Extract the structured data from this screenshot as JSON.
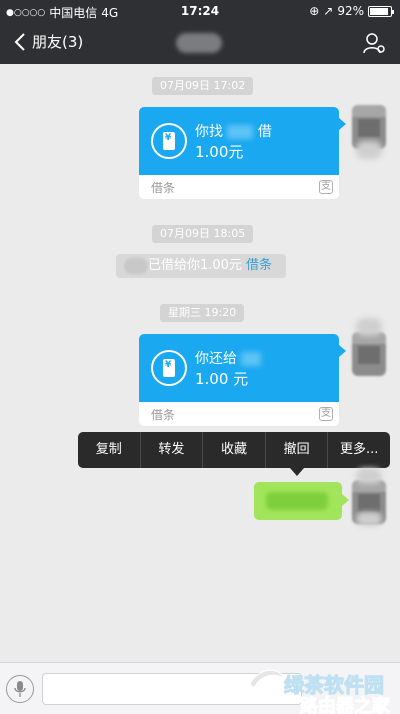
{
  "status_bar": {
    "signal": "●○○○○",
    "carrier": "中国电信",
    "network": "4G",
    "time": "17:24",
    "battery": "92%",
    "battery_level": 0.92
  },
  "nav": {
    "back_label": "朋友(3)"
  },
  "timestamps": [
    "07月09日 17:02",
    "07月09日 18:05",
    "星期三 19:20"
  ],
  "cards": [
    {
      "title": "你找",
      "title_suffix": "借",
      "amount": "1.00元",
      "footer": "借条"
    },
    {
      "title": "你还给",
      "title_suffix": "",
      "amount": "1.00 元",
      "footer": "借条"
    }
  ],
  "system_message": {
    "text": "已借给你1.00元",
    "link": "借条"
  },
  "context_menu": [
    "复制",
    "转发",
    "收藏",
    "撤回",
    "更多..."
  ],
  "watermark": {
    "line1": "绿茶软件园",
    "line2": "路由器之家"
  },
  "colors": {
    "nav_bg": "#2f3033",
    "card_blue": "#1aa8f0",
    "green_bubble": "#a2e55c"
  }
}
